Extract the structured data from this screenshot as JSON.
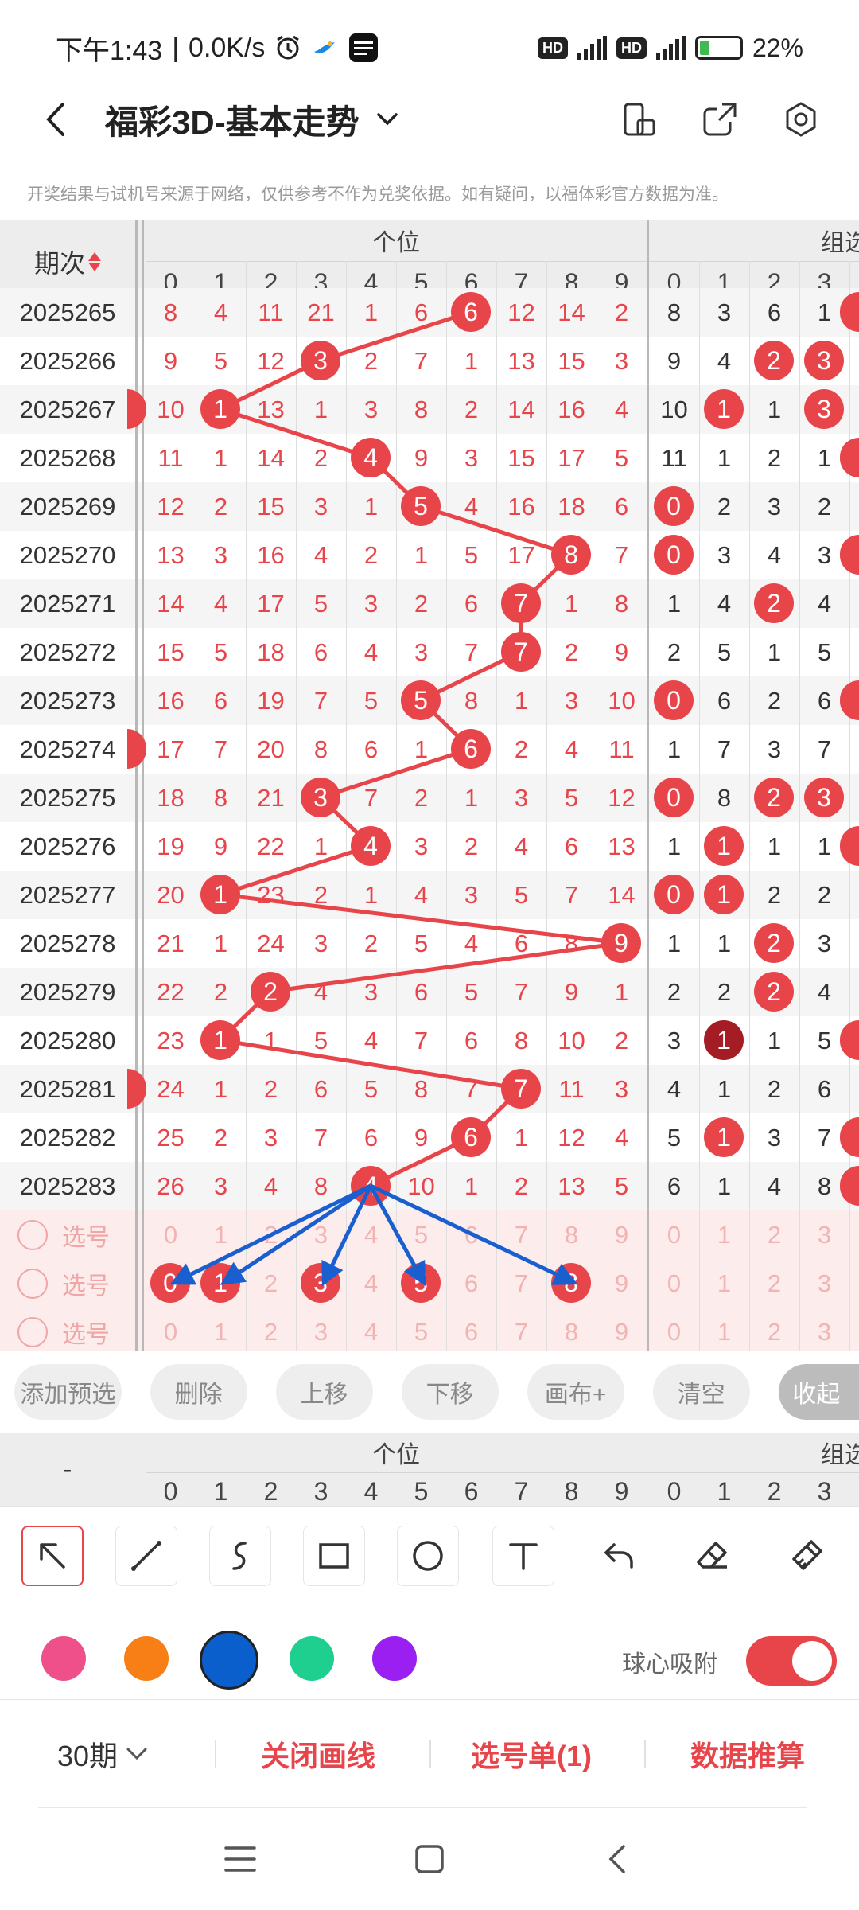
{
  "status_bar": {
    "time": "下午1:43",
    "speed": "0.0K/s",
    "hd": "HD",
    "net1": "5G",
    "net2": "4G",
    "battery": "22%"
  },
  "app_bar": {
    "title": "福彩3D-基本走势"
  },
  "disclaimer": "开奖结果与试机号来源于网络，仅供参考不作为兑奖依据。如有疑问，以福体彩官方数据为准。",
  "table": {
    "period_header": "期次",
    "group_units": "个位",
    "group_combo": "组选",
    "unit_digits": [
      "0",
      "1",
      "2",
      "3",
      "4",
      "5",
      "6",
      "7",
      "8",
      "9"
    ],
    "combo_digits": [
      "0",
      "1",
      "2",
      "3"
    ],
    "rows": [
      {
        "period": "2025265",
        "units": [
          "8",
          "4",
          "11",
          "21",
          "1",
          "6",
          "6",
          "12",
          "14",
          "2"
        ],
        "hit": 6,
        "combo": [
          "8",
          "3",
          "6",
          "1"
        ],
        "combo_hits": [],
        "left_dot": false,
        "right_dot": true
      },
      {
        "period": "2025266",
        "units": [
          "9",
          "5",
          "12",
          "3",
          "2",
          "7",
          "1",
          "13",
          "15",
          "3"
        ],
        "hit": 3,
        "combo": [
          "9",
          "4",
          "2",
          "3"
        ],
        "combo_hits": [
          2,
          3
        ],
        "left_dot": false,
        "right_dot": false
      },
      {
        "period": "2025267",
        "units": [
          "10",
          "1",
          "13",
          "1",
          "3",
          "8",
          "2",
          "14",
          "16",
          "4"
        ],
        "hit": 1,
        "combo": [
          "10",
          "1",
          "1",
          "3"
        ],
        "combo_hits": [
          1,
          3
        ],
        "left_dot": true,
        "right_dot": false
      },
      {
        "period": "2025268",
        "units": [
          "11",
          "1",
          "14",
          "2",
          "4",
          "9",
          "3",
          "15",
          "17",
          "5"
        ],
        "hit": 4,
        "combo": [
          "11",
          "1",
          "2",
          "1"
        ],
        "combo_hits": [],
        "left_dot": false,
        "right_dot": true
      },
      {
        "period": "2025269",
        "units": [
          "12",
          "2",
          "15",
          "3",
          "1",
          "5",
          "4",
          "16",
          "18",
          "6"
        ],
        "hit": 5,
        "combo": [
          "0",
          "2",
          "3",
          "2"
        ],
        "combo_hits": [
          0
        ],
        "left_dot": false,
        "right_dot": false
      },
      {
        "period": "2025270",
        "units": [
          "13",
          "3",
          "16",
          "4",
          "2",
          "1",
          "5",
          "17",
          "8",
          "7"
        ],
        "hit": 8,
        "combo": [
          "0",
          "3",
          "4",
          "3"
        ],
        "combo_hits": [
          0
        ],
        "left_dot": false,
        "right_dot": true
      },
      {
        "period": "2025271",
        "units": [
          "14",
          "4",
          "17",
          "5",
          "3",
          "2",
          "6",
          "7",
          "1",
          "8"
        ],
        "hit": 7,
        "combo": [
          "1",
          "4",
          "2",
          "4"
        ],
        "combo_hits": [
          2
        ],
        "left_dot": false,
        "right_dot": false
      },
      {
        "period": "2025272",
        "units": [
          "15",
          "5",
          "18",
          "6",
          "4",
          "3",
          "7",
          "7",
          "2",
          "9"
        ],
        "hit": 7,
        "combo": [
          "2",
          "5",
          "1",
          "5"
        ],
        "combo_hits": [],
        "left_dot": false,
        "right_dot": false
      },
      {
        "period": "2025273",
        "units": [
          "16",
          "6",
          "19",
          "7",
          "5",
          "5",
          "8",
          "1",
          "3",
          "10"
        ],
        "hit": 5,
        "combo": [
          "0",
          "6",
          "2",
          "6"
        ],
        "combo_hits": [
          0
        ],
        "left_dot": false,
        "right_dot": true
      },
      {
        "period": "2025274",
        "units": [
          "17",
          "7",
          "20",
          "8",
          "6",
          "1",
          "6",
          "2",
          "4",
          "11"
        ],
        "hit": 6,
        "combo": [
          "1",
          "7",
          "3",
          "7"
        ],
        "combo_hits": [],
        "left_dot": true,
        "right_dot": false
      },
      {
        "period": "2025275",
        "units": [
          "18",
          "8",
          "21",
          "3",
          "7",
          "2",
          "1",
          "3",
          "5",
          "12"
        ],
        "hit": 3,
        "combo": [
          "0",
          "8",
          "2",
          "3"
        ],
        "combo_hits": [
          0,
          2,
          3
        ],
        "left_dot": false,
        "right_dot": false
      },
      {
        "period": "2025276",
        "units": [
          "19",
          "9",
          "22",
          "1",
          "4",
          "3",
          "2",
          "4",
          "6",
          "13"
        ],
        "hit": 4,
        "combo": [
          "1",
          "1",
          "1",
          "1"
        ],
        "combo_hits": [
          1
        ],
        "left_dot": false,
        "right_dot": true
      },
      {
        "period": "2025277",
        "units": [
          "20",
          "1",
          "23",
          "2",
          "1",
          "4",
          "3",
          "5",
          "7",
          "14"
        ],
        "hit": 1,
        "combo": [
          "0",
          "1",
          "2",
          "2"
        ],
        "combo_hits": [
          0,
          1
        ],
        "left_dot": false,
        "right_dot": false
      },
      {
        "period": "2025278",
        "units": [
          "21",
          "1",
          "24",
          "3",
          "2",
          "5",
          "4",
          "6",
          "8",
          "9"
        ],
        "hit": 9,
        "combo": [
          "1",
          "1",
          "2",
          "3"
        ],
        "combo_hits": [
          2
        ],
        "left_dot": false,
        "right_dot": false
      },
      {
        "period": "2025279",
        "units": [
          "22",
          "2",
          "2",
          "4",
          "3",
          "6",
          "5",
          "7",
          "9",
          "1"
        ],
        "hit": 2,
        "combo": [
          "2",
          "2",
          "2",
          "4"
        ],
        "combo_hits": [
          2
        ],
        "left_dot": false,
        "right_dot": false
      },
      {
        "period": "2025280",
        "units": [
          "23",
          "1",
          "1",
          "5",
          "4",
          "7",
          "6",
          "8",
          "10",
          "2"
        ],
        "hit": 1,
        "combo": [
          "3",
          "1",
          "1",
          "5"
        ],
        "combo_hits": [
          1
        ],
        "dark_hit": 1,
        "left_dot": false,
        "right_dot": true
      },
      {
        "period": "2025281",
        "units": [
          "24",
          "1",
          "2",
          "6",
          "5",
          "8",
          "7",
          "7",
          "11",
          "3"
        ],
        "hit": 7,
        "combo": [
          "4",
          "1",
          "2",
          "6"
        ],
        "combo_hits": [],
        "left_dot": true,
        "right_dot": false
      },
      {
        "period": "2025282",
        "units": [
          "25",
          "2",
          "3",
          "7",
          "6",
          "9",
          "6",
          "1",
          "12",
          "4"
        ],
        "hit": 6,
        "combo": [
          "5",
          "1",
          "3",
          "7"
        ],
        "combo_hits": [
          1
        ],
        "left_dot": false,
        "right_dot": true
      },
      {
        "period": "2025283",
        "units": [
          "26",
          "3",
          "4",
          "8",
          "4",
          "10",
          "1",
          "2",
          "13",
          "5"
        ],
        "hit": 4,
        "combo": [
          "6",
          "1",
          "4",
          "8"
        ],
        "combo_hits": [],
        "left_dot": false,
        "right_dot": true
      }
    ],
    "pick_rows": [
      {
        "label": "选号",
        "selected": []
      },
      {
        "label": "选号",
        "selected": [
          0,
          1,
          3,
          5,
          8
        ]
      },
      {
        "label": "选号",
        "selected": []
      }
    ]
  },
  "actions": {
    "add_preselect": "添加预选",
    "delete": "删除",
    "move_up": "上移",
    "move_down": "下移",
    "canvas_plus": "画布+",
    "clear": "清空",
    "collapse": "收起"
  },
  "mini_header": {
    "period_placeholder": "-",
    "group_units": "个位",
    "group_combo": "组选"
  },
  "tools": [
    {
      "name": "arrow-select-tool-icon"
    },
    {
      "name": "line-tool-icon"
    },
    {
      "name": "curve-tool-icon"
    },
    {
      "name": "rectangle-tool-icon"
    },
    {
      "name": "circle-tool-icon"
    },
    {
      "name": "text-tool-icon"
    },
    {
      "name": "undo-icon"
    },
    {
      "name": "eraser-icon"
    },
    {
      "name": "clear-brush-icon"
    }
  ],
  "colors": {
    "swatches": [
      "#f0508a",
      "#f77f16",
      "#0b5fcd",
      "#1fcf8f",
      "#9a1ff0"
    ],
    "selected_index": 2,
    "accent": "#e8454b",
    "line_red": "#e8454b",
    "arrow_blue": "#1a5fcf"
  },
  "snap": {
    "label": "球心吸附",
    "enabled": true
  },
  "bottom_bar": {
    "period_select": "30期",
    "close_lines": "关闭画线",
    "pick_list": "选号单(1)",
    "data_calc": "数据推算"
  }
}
